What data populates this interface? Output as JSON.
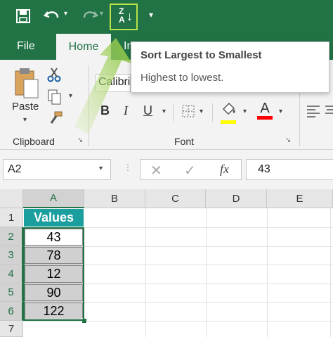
{
  "qat": {
    "save_icon": "save-icon",
    "undo_icon": "undo-icon",
    "redo_icon": "redo-icon",
    "sort_icon": "sort-z-to-a-icon",
    "customize_icon": "customize-qat-icon"
  },
  "tabs": {
    "file": "File",
    "home": "Home",
    "insert_partial": "In"
  },
  "tooltip": {
    "title": "Sort Largest to Smallest",
    "desc": "Highest to lowest."
  },
  "ribbon": {
    "paste_label": "Paste",
    "clipboard_label": "Clipboard",
    "font_label": "Font",
    "font_name": "Calibri",
    "bold": "B",
    "italic": "I",
    "underline": "U",
    "font_color_letter": "A",
    "highlight_color": "#ffff00",
    "font_color": "#ff0000"
  },
  "formula_bar": {
    "name_box": "A2",
    "fx": "fx",
    "value": "43"
  },
  "sheet": {
    "columns": [
      "A",
      "B",
      "C",
      "D",
      "E"
    ],
    "rows": [
      "1",
      "2",
      "3",
      "4",
      "5",
      "6",
      "7"
    ],
    "header_cell": "Values",
    "values": [
      "43",
      "78",
      "12",
      "90",
      "122"
    ],
    "header_color": "#1a9e9e",
    "selected_fill": "#d0d0d0"
  }
}
